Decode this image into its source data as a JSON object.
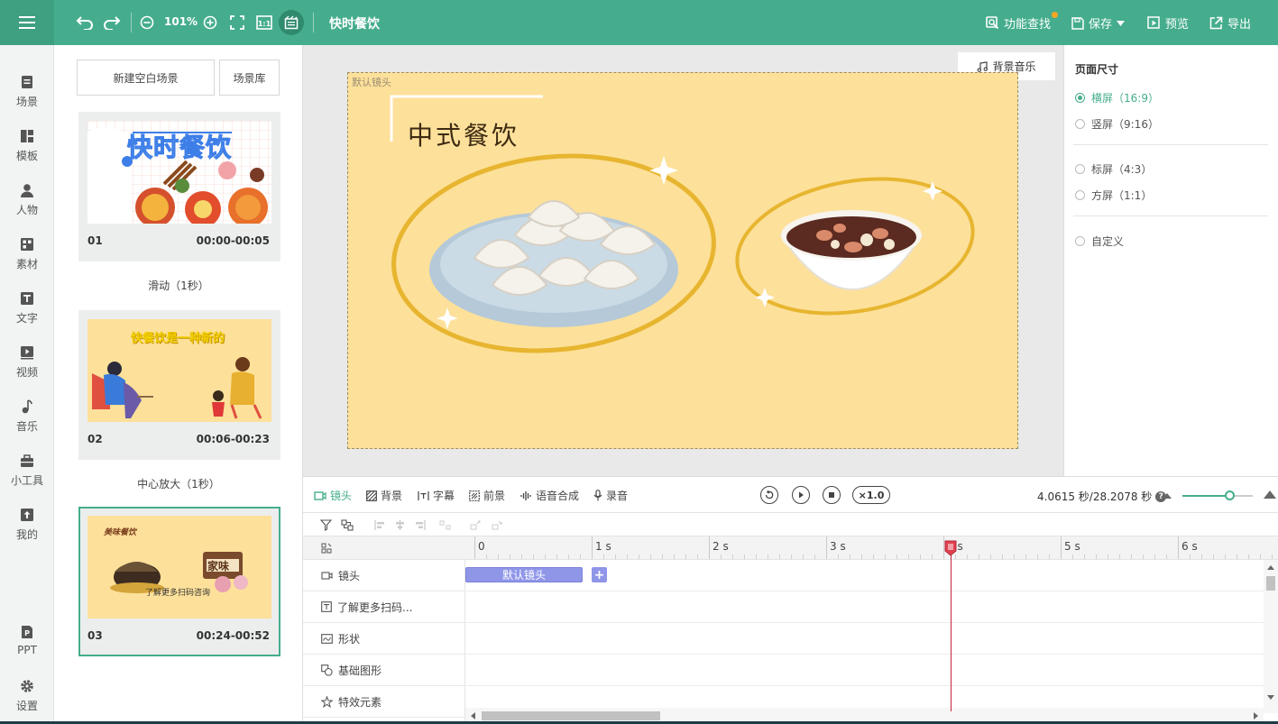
{
  "topbar": {
    "zoom": "101%",
    "project_title": "快时餐饮",
    "find_label": "功能查找",
    "save_label": "保存",
    "preview_label": "预览",
    "export_label": "导出",
    "brand_color": "#45ad8d"
  },
  "sidebar": {
    "items": [
      {
        "label": "场景",
        "icon": "scene-icon"
      },
      {
        "label": "模板",
        "icon": "template-icon"
      },
      {
        "label": "人物",
        "icon": "person-icon"
      },
      {
        "label": "素材",
        "icon": "material-icon"
      },
      {
        "label": "文字",
        "icon": "text-icon"
      },
      {
        "label": "视频",
        "icon": "video-icon"
      },
      {
        "label": "音乐",
        "icon": "music-icon"
      },
      {
        "label": "小工具",
        "icon": "toolbox-icon"
      },
      {
        "label": "我的",
        "icon": "upload-icon"
      },
      {
        "label": "PPT",
        "icon": "ppt-icon"
      },
      {
        "label": "设置",
        "icon": "gear-icon"
      }
    ]
  },
  "scenes": {
    "new_blank_label": "新建空白场景",
    "library_label": "场景库",
    "cards": [
      {
        "index": "01",
        "time": "00:00-00:05",
        "thumb_text": "快时餐饮",
        "transition": "滑动（1秒）"
      },
      {
        "index": "02",
        "time": "00:06-00:23",
        "thumb_text": "快餐饮是一种新的",
        "transition": "中心放大（1秒）"
      },
      {
        "index": "03",
        "time": "00:24-00:52",
        "thumb_text": "了解更多扫码咨询",
        "thumb_title": "美味餐饮",
        "thumb_sign": "家味"
      }
    ]
  },
  "stage": {
    "lens_label": "默认镜头",
    "heading": "中式餐饮",
    "bgm_label": "背景音乐"
  },
  "props": {
    "title": "页面尺寸",
    "options": [
      {
        "label": "横屏（16:9）",
        "selected": true
      },
      {
        "label": "竖屏（9:16）",
        "selected": false
      },
      {
        "label": "标屏（4:3）",
        "selected": false
      },
      {
        "label": "方屏（1:1）",
        "selected": false
      },
      {
        "label": "自定义",
        "selected": false
      }
    ]
  },
  "timeline": {
    "tabs": [
      {
        "label": "镜头",
        "icon": "camera-icon",
        "active": true
      },
      {
        "label": "背景",
        "icon": "background-icon",
        "active": false
      },
      {
        "label": "字幕",
        "icon": "subtitle-icon",
        "active": false
      },
      {
        "label": "前景",
        "icon": "foreground-icon",
        "active": false
      },
      {
        "label": "语音合成",
        "icon": "voice-synthesis-icon",
        "active": false
      },
      {
        "label": "录音",
        "icon": "microphone-icon",
        "active": false
      }
    ],
    "speed": "×1.0",
    "time_readout": "4.0615 秒/28.2078 秒",
    "zoom_level": 0.67,
    "ruler_ticks": [
      "0",
      "1 s",
      "2 s",
      "3 s",
      "4 s",
      "5 s",
      "6 s"
    ],
    "tracks": [
      {
        "label": "镜头",
        "icon": "camera-icon"
      },
      {
        "label": "了解更多扫码...",
        "icon": "text-box-icon"
      },
      {
        "label": "形状",
        "icon": "shape-icon"
      },
      {
        "label": "基础图形",
        "icon": "basic-shape-icon"
      },
      {
        "label": "特效元素",
        "icon": "effect-star-icon"
      }
    ],
    "clip_label": "默认镜头",
    "playhead_seconds": 4.0615
  }
}
